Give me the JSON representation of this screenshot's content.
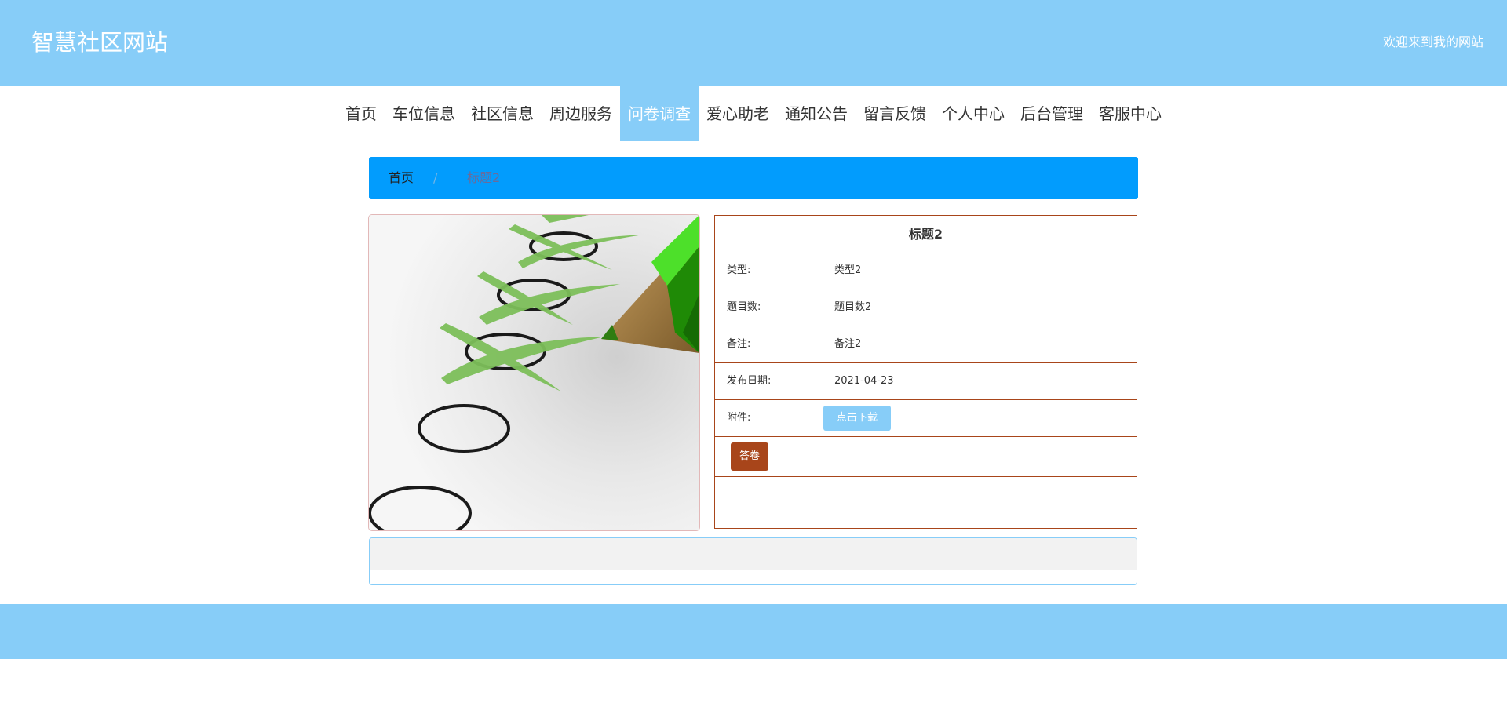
{
  "header": {
    "site_title": "智慧社区网站",
    "welcome": "欢迎来到我的网站"
  },
  "nav": {
    "items": [
      {
        "label": "首页",
        "active": false
      },
      {
        "label": "车位信息",
        "active": false
      },
      {
        "label": "社区信息",
        "active": false
      },
      {
        "label": "周边服务",
        "active": false
      },
      {
        "label": "问卷调查",
        "active": true
      },
      {
        "label": "爱心助老",
        "active": false
      },
      {
        "label": "通知公告",
        "active": false
      },
      {
        "label": "留言反馈",
        "active": false
      },
      {
        "label": "个人中心",
        "active": false
      },
      {
        "label": "后台管理",
        "active": false
      },
      {
        "label": "客服中心",
        "active": false
      }
    ]
  },
  "breadcrumb": {
    "home": "首页",
    "separator": "/",
    "current": "标题2"
  },
  "detail": {
    "title": "标题2",
    "type_label": "类型:",
    "type_value": "类型2",
    "count_label": "题目数:",
    "count_value": "题目数2",
    "remark_label": "备注:",
    "remark_value": "备注2",
    "date_label": "发布日期:",
    "date_value": "2021-04-23",
    "attachment_label": "附件:",
    "download_button": "点击下载",
    "answer_button": "答卷"
  },
  "image": {
    "icon": "survey-checklist-pencil-image"
  },
  "colors": {
    "primary": "#87cdf8",
    "breadcrumb": "#029cfd",
    "accent": "#a8451a"
  }
}
